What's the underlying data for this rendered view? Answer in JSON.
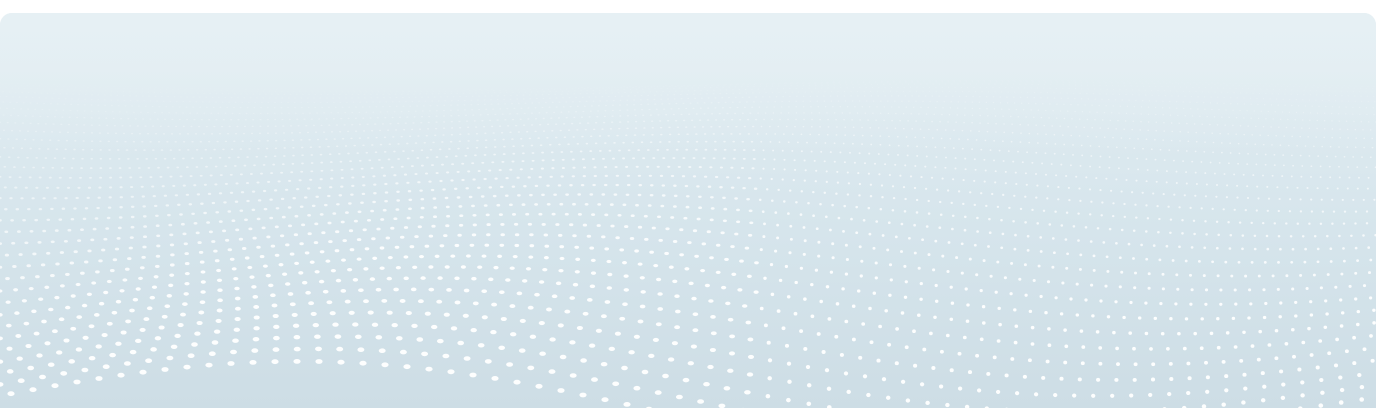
{
  "banner": {
    "colors": {
      "top": "#e3eef3",
      "middle": "#d6e5ec",
      "bottom": "#cddde5",
      "dot": "#ffffff"
    },
    "pattern": "wavy-dot-grid"
  }
}
